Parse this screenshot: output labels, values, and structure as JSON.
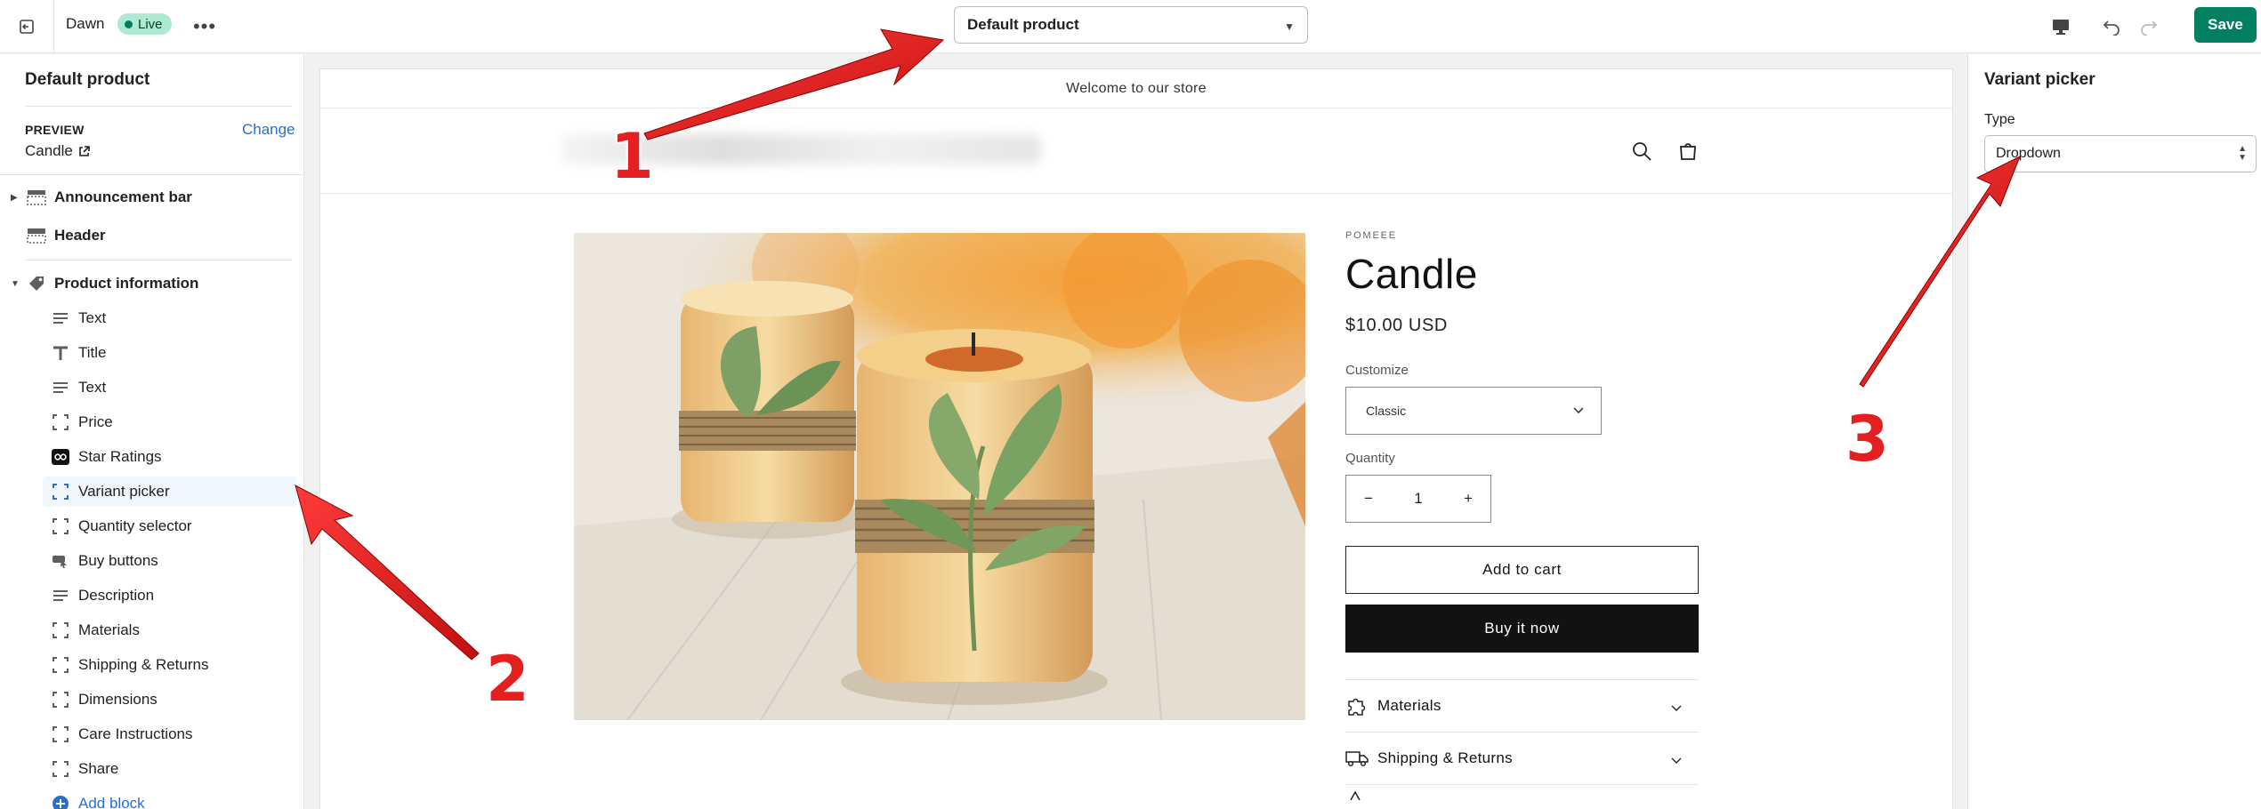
{
  "topbar": {
    "theme_name": "Dawn",
    "live_badge": "Live",
    "template_select": "Default product",
    "save_label": "Save"
  },
  "sidebar": {
    "title": "Default product",
    "preview_label": "PREVIEW",
    "change_link": "Change",
    "preview_product": "Candle",
    "sections": [
      {
        "label": "Announcement bar",
        "icon": "announcement-bar-icon"
      },
      {
        "label": "Header",
        "icon": "header-icon"
      },
      {
        "label": "Product information",
        "icon": "tag-icon"
      }
    ],
    "blocks": [
      {
        "label": "Text",
        "icon": "text-lines-icon"
      },
      {
        "label": "Title",
        "icon": "title-T-icon"
      },
      {
        "label": "Text",
        "icon": "text-lines-icon"
      },
      {
        "label": "Price",
        "icon": "frame-icon"
      },
      {
        "label": "Star Ratings",
        "icon": "infinity-app-icon"
      },
      {
        "label": "Variant picker",
        "icon": "frame-icon"
      },
      {
        "label": "Quantity selector",
        "icon": "frame-icon"
      },
      {
        "label": "Buy buttons",
        "icon": "buy-buttons-icon"
      },
      {
        "label": "Description",
        "icon": "text-lines-icon"
      },
      {
        "label": "Materials",
        "icon": "frame-icon"
      },
      {
        "label": "Shipping & Returns",
        "icon": "frame-icon"
      },
      {
        "label": "Dimensions",
        "icon": "frame-icon"
      },
      {
        "label": "Care Instructions",
        "icon": "frame-icon"
      },
      {
        "label": "Share",
        "icon": "frame-icon"
      }
    ],
    "add_block": "Add block"
  },
  "preview": {
    "announcement": "Welcome to our store",
    "vendor": "POMEEE",
    "product_title": "Candle",
    "price": "$10.00 USD",
    "customize_label": "Customize",
    "customize_value": "Classic",
    "quantity_label": "Quantity",
    "quantity_minus": "−",
    "quantity_value": "1",
    "quantity_plus": "+",
    "add_to_cart": "Add to cart",
    "buy_now": "Buy it now",
    "accordions": [
      {
        "label": "Materials",
        "icon": "puzzle-icon"
      },
      {
        "label": "Shipping & Returns",
        "icon": "truck-icon"
      }
    ]
  },
  "settings": {
    "title": "Variant picker",
    "type_label": "Type",
    "type_value": "Dropdown"
  },
  "annotations": {
    "one": "1",
    "two": "2",
    "three": "3"
  },
  "colors": {
    "save_green": "#008060",
    "live_badge": "#aee9d1",
    "link_blue": "#2c6ecb",
    "annotation_red": "#e41f1f"
  }
}
